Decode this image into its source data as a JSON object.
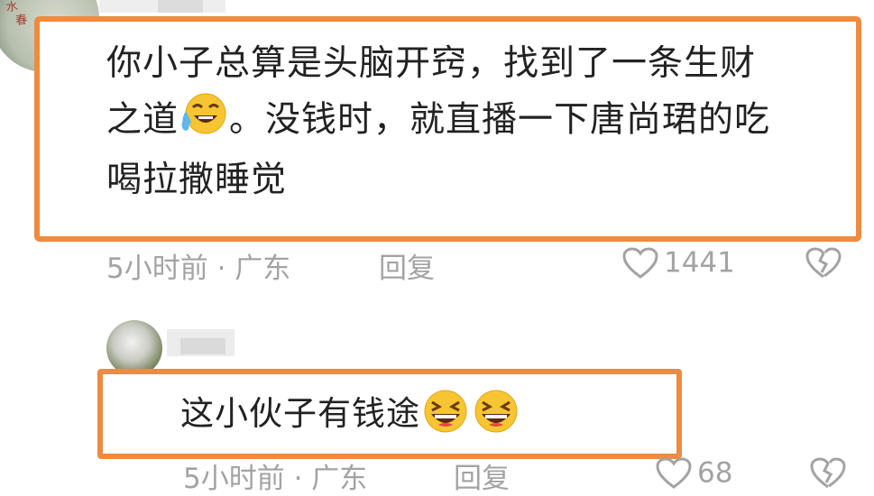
{
  "comments": [
    {
      "text_line1": "你小子总算是头脑开窍，找到了一条生财",
      "text_line2_a": "之道",
      "text_line2_b": "。没钱时，就直播一下唐尚珺的吃",
      "text_line3": "喝拉撒睡觉",
      "emoji": "laughing-crying-emoji",
      "time": "5小时前 · 广东",
      "reply_label": "回复",
      "likes": "1441"
    },
    {
      "text": "这小伙子有钱途",
      "emoji": "laughing-face-emoji",
      "time": "5小时前 · 广东",
      "reply_label": "回复",
      "likes": "68"
    }
  ],
  "colors": {
    "highlight": "#f08a3c",
    "meta_text": "#a3a3a3",
    "body_text": "#222222"
  }
}
